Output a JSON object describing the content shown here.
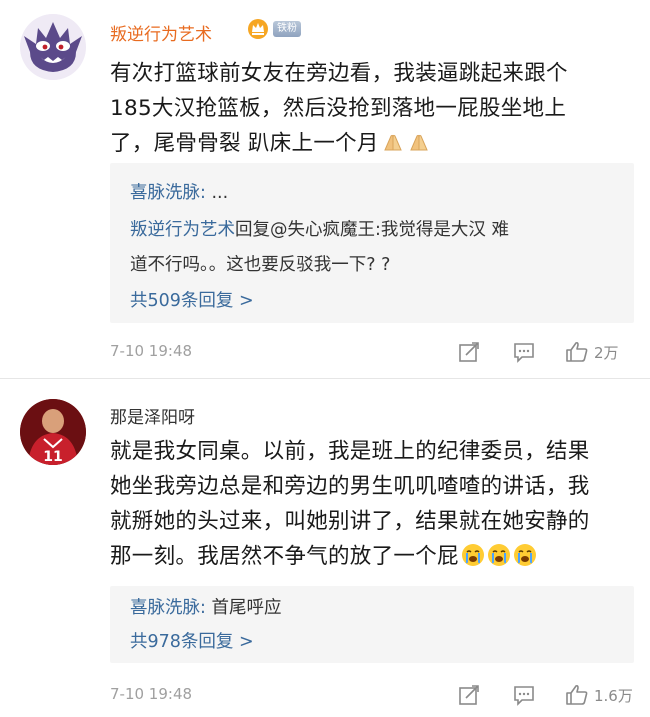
{
  "comments": [
    {
      "username": "叛逆行为艺术",
      "vip_icon": "crown-vip-icon",
      "fan_badge": "铁粉",
      "body_lines": [
        "有次打篮球前女友在旁边看，我装逼跳起来跟个",
        "185大汉抢篮板，然后没抢到落地一屁股坐地上",
        "了，尾骨骨裂 趴床上一个月"
      ],
      "emojis": [
        "pray-hands-icon",
        "pray-hands-icon"
      ],
      "replies": [
        {
          "user": "喜脉洗脉:",
          "text": " ..."
        },
        {
          "user": "叛逆行为艺术",
          "text": "回复@失心疯魔王:我觉得是大汉 难"
        },
        {
          "user": "",
          "text": "道不行吗。。这也要反驳我一下? ?"
        }
      ],
      "more_replies": "共509条回复 >",
      "timestamp": "7-10 19:48",
      "likes": "2万"
    },
    {
      "username": "那是泽阳呀",
      "body_lines": [
        "就是我女同桌。以前，我是班上的纪律委员，结果",
        "她坐我旁边总是和旁边的男生叽叽喳喳的讲话，我",
        "就掰她的头过来，叫她别讲了，结果就在她安静的",
        "那一刻。我居然不争气的放了一个屁"
      ],
      "emojis": [
        "crying-face-icon",
        "crying-face-icon",
        "crying-face-icon"
      ],
      "replies": [
        {
          "user": "喜脉洗脉:",
          "text": " 首尾呼应"
        }
      ],
      "more_replies": "共978条回复 >",
      "timestamp": "7-10 19:48",
      "likes": "1.6万"
    }
  ],
  "colors": {
    "username_orange": "#e86b20",
    "link_blue": "#3a6a9c",
    "reply_bg": "#f5f5f5",
    "meta_gray": "#a0a0a0"
  }
}
